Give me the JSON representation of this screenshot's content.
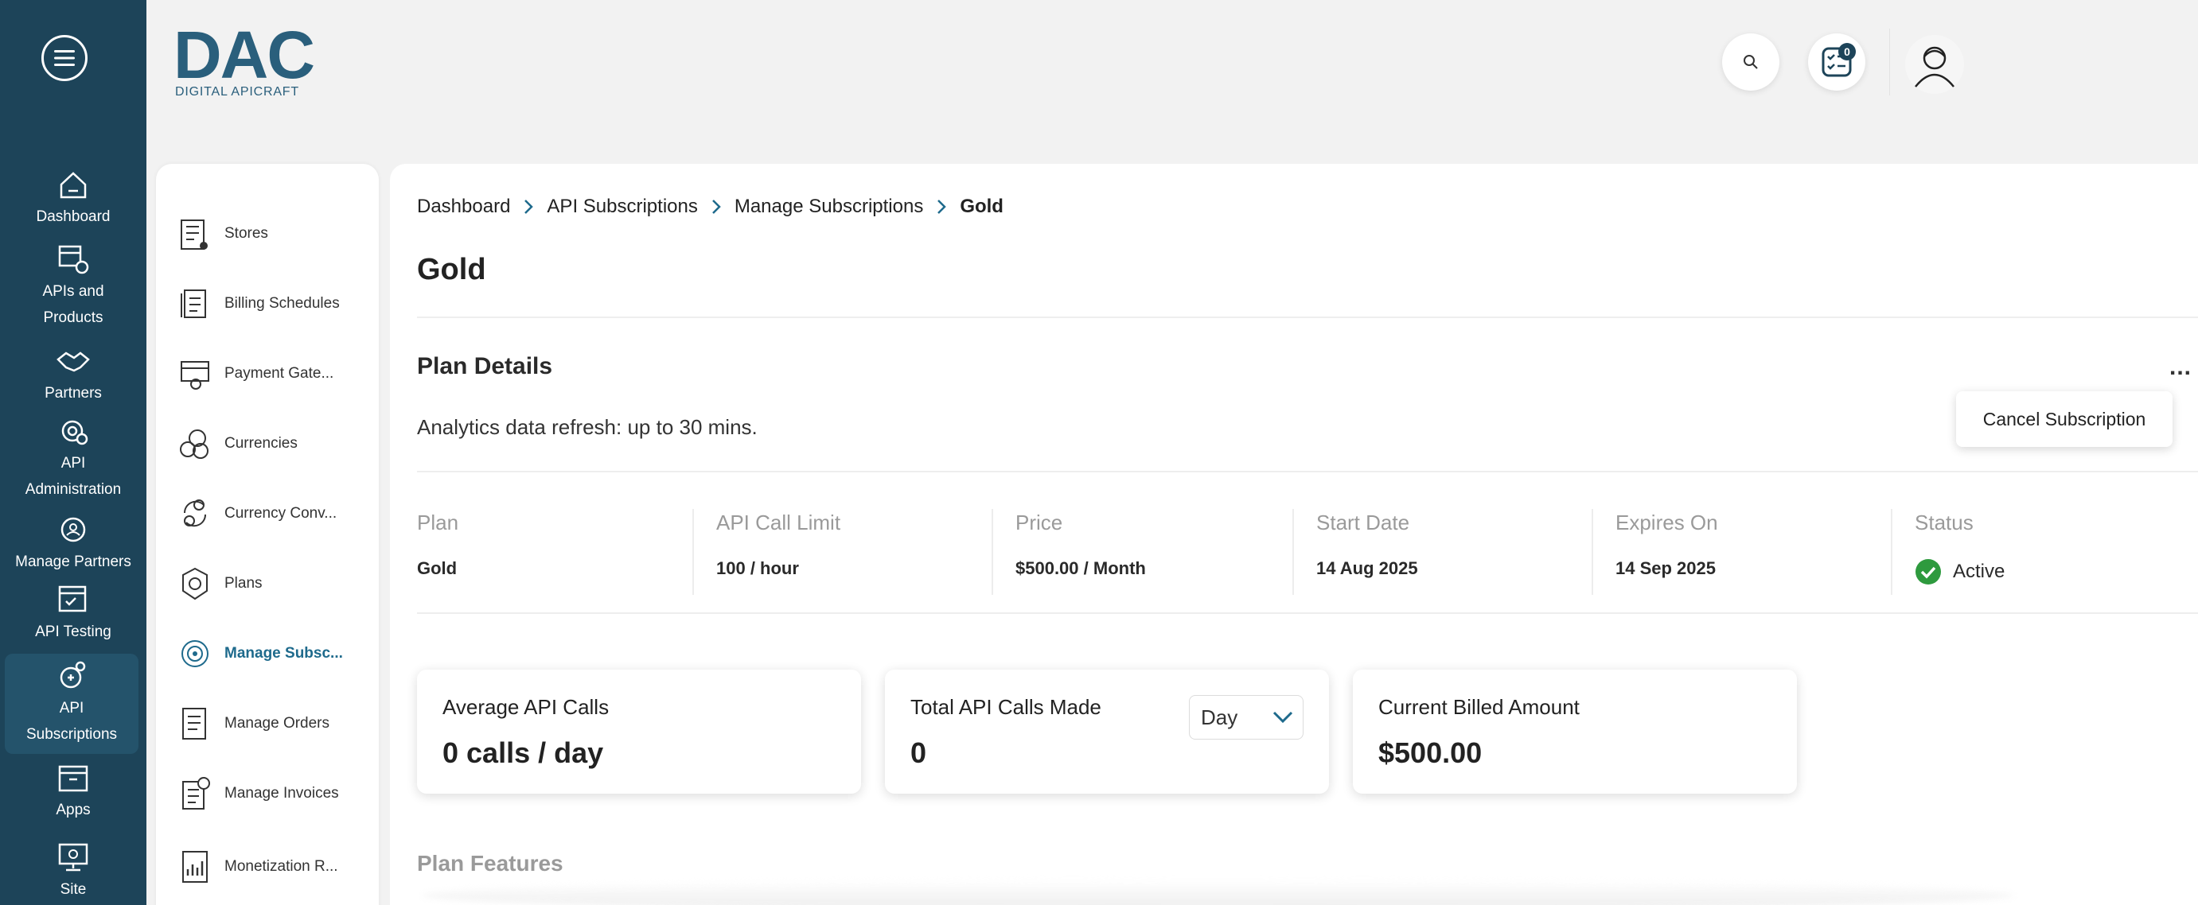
{
  "rail": {
    "items": [
      {
        "label": "Dashboard"
      },
      {
        "label": "APIs and Products"
      },
      {
        "label": "Partners"
      },
      {
        "label": "API Administration"
      },
      {
        "label": "Manage Partners"
      },
      {
        "label": "API Testing"
      },
      {
        "label": "API Subscriptions"
      },
      {
        "label": "Apps"
      },
      {
        "label": "Site"
      }
    ]
  },
  "logo": {
    "mark": "DAC",
    "tagline": "DIGITAL APICRAFT"
  },
  "topbar": {
    "tasks_badge": "0"
  },
  "subnav": {
    "items": [
      {
        "label": "Stores"
      },
      {
        "label": "Billing Schedules"
      },
      {
        "label": "Payment Gate..."
      },
      {
        "label": "Currencies"
      },
      {
        "label": "Currency Conv..."
      },
      {
        "label": "Plans"
      },
      {
        "label": "Manage Subsc..."
      },
      {
        "label": "Manage Orders"
      },
      {
        "label": "Manage Invoices"
      },
      {
        "label": "Monetization R..."
      }
    ]
  },
  "breadcrumb": [
    "Dashboard",
    "API Subscriptions",
    "Manage Subscriptions",
    "Gold"
  ],
  "page_title": "Gold",
  "plan_details": {
    "title": "Plan Details",
    "more": "...",
    "refresh_note": "Analytics data refresh: up to 30 mins.",
    "menu": {
      "cancel_label": "Cancel Subscription"
    },
    "columns": [
      {
        "header": "Plan",
        "value": "Gold"
      },
      {
        "header": "API Call Limit",
        "value": "100 / hour"
      },
      {
        "header": "Price",
        "value": "$500.00 / Month"
      },
      {
        "header": "Start Date",
        "value": "14 Aug 2025"
      },
      {
        "header": "Expires On",
        "value": "14 Sep 2025"
      },
      {
        "header": "Status",
        "value": "Active"
      }
    ]
  },
  "cards": [
    {
      "label": "Average API Calls",
      "value": "0 calls / day"
    },
    {
      "label": "Total API Calls Made",
      "value": "0",
      "select": "Day"
    },
    {
      "label": "Current Billed Amount",
      "value": "$500.00"
    }
  ],
  "features_title": "Plan Features",
  "colors": {
    "rail": "#1d4459",
    "accent": "#1e6a8c",
    "success": "#2e9a3e"
  }
}
